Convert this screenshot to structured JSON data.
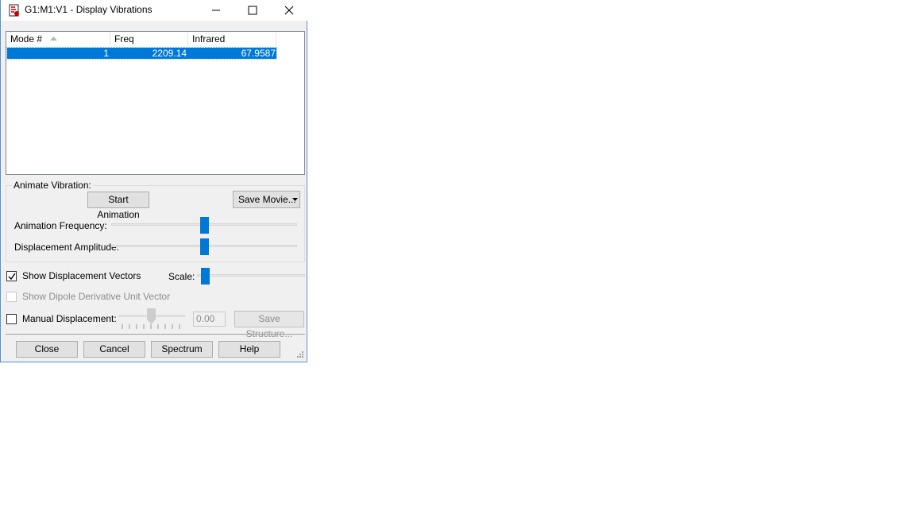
{
  "window": {
    "title": "G1:M1:V1 - Display Vibrations"
  },
  "table": {
    "columns": [
      "Mode #",
      "Freq",
      "Infrared"
    ],
    "rows": [
      {
        "mode": "1",
        "freq": "2209.14",
        "infrared": "67.9587",
        "selected": true
      }
    ]
  },
  "animate": {
    "group_label": "Animate Vibration:",
    "start_button": "Start Animation",
    "save_movie_button": "Save Movie...",
    "freq_label": "Animation Frequency:",
    "amp_label": "Displacement Amplitude:",
    "freq_level": 0.5,
    "amp_level": 0.5
  },
  "vectors": {
    "show_displacement_label": "Show Displacement Vectors",
    "show_displacement_checked": true,
    "scale_label": "Scale:",
    "scale_level": 0.07,
    "dipole_label": "Show Dipole Derivative Unit Vector",
    "dipole_enabled": false
  },
  "manual": {
    "label": "Manual Displacement:",
    "checked": false,
    "value": "0.00",
    "save_structure_button": "Save Structure..."
  },
  "footer": {
    "close": "Close",
    "cancel": "Cancel",
    "spectrum": "Spectrum",
    "help": "Help"
  },
  "colors": {
    "selection": "#0078d7",
    "dialog_bg": "#f0f0f0"
  }
}
